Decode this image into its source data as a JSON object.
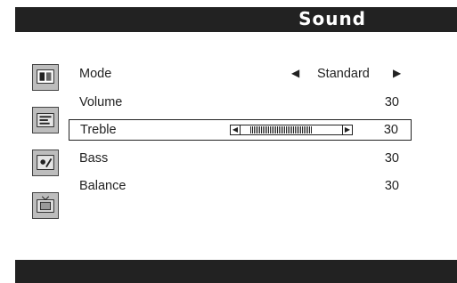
{
  "header": {
    "title": "Sound"
  },
  "menu": {
    "items": [
      {
        "label": "Mode",
        "value": "Standard"
      },
      {
        "label": "Volume",
        "value": "30"
      },
      {
        "label": "Treble",
        "value": "30"
      },
      {
        "label": "Bass",
        "value": "30"
      },
      {
        "label": "Balance",
        "value": "30"
      }
    ],
    "selected_index": 2,
    "treble_slider_level": 0.6
  },
  "sidebar": {
    "icons": [
      "picture-icon",
      "sound-icon",
      "setup-icon",
      "tv-icon"
    ]
  }
}
